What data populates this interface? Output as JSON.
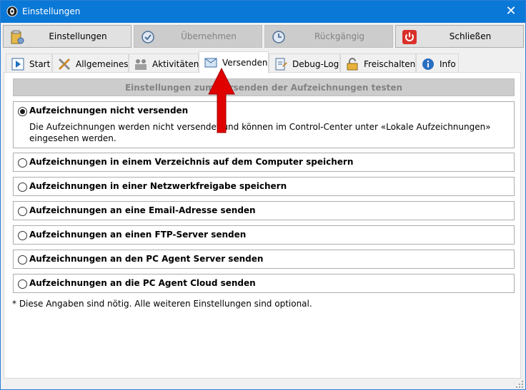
{
  "window": {
    "title": "Einstellungen",
    "close_glyph": "✕"
  },
  "toolbar": [
    {
      "label": "Einstellungen",
      "icon": "settings-folder-icon",
      "disabled": false
    },
    {
      "label": "Übernehmen",
      "icon": "apply-clock-icon",
      "disabled": true
    },
    {
      "label": "Rückgängig",
      "icon": "undo-clock-icon",
      "disabled": true
    },
    {
      "label": "Schließen",
      "icon": "power-icon",
      "disabled": false
    }
  ],
  "tabs": [
    {
      "label": "Start",
      "icon": "play-icon",
      "active": false
    },
    {
      "label": "Allgemeines",
      "icon": "tools-icon",
      "active": false
    },
    {
      "label": "Aktivitäten",
      "icon": "users-icon",
      "active": false
    },
    {
      "label": "Versenden",
      "icon": "envelope-icon",
      "active": true
    },
    {
      "label": "Debug-Log",
      "icon": "notepad-icon",
      "active": false
    },
    {
      "label": "Freischalten",
      "icon": "lock-icon",
      "active": false
    },
    {
      "label": "Info",
      "icon": "info-icon",
      "active": false
    }
  ],
  "panel": {
    "test_button": "Einstellungen zum Versenden der Aufzeichnungen testen",
    "options": [
      {
        "label": "Aufzeichnungen nicht versenden",
        "checked": true,
        "description": "Die Aufzeichnungen werden nicht versendet und können im Control-Center unter «Lokale Aufzeichnungen» eingesehen werden."
      },
      {
        "label": "Aufzeichnungen in einem Verzeichnis auf dem Computer speichern",
        "checked": false
      },
      {
        "label": "Aufzeichnungen in einer Netzwerkfreigabe speichern",
        "checked": false
      },
      {
        "label": "Aufzeichnungen an eine Email-Adresse senden",
        "checked": false
      },
      {
        "label": "Aufzeichnungen an einen FTP-Server senden",
        "checked": false
      },
      {
        "label": "Aufzeichnungen an den PC Agent Server senden",
        "checked": false
      },
      {
        "label": "Aufzeichnungen an die PC Agent Cloud senden",
        "checked": false
      }
    ],
    "footnote": "* Diese Angaben sind nötig. Alle weiteren Einstellungen sind optional."
  },
  "colors": {
    "titlebar": "#0a78d7",
    "arrow": "#e00000",
    "disabled_text": "#838383"
  }
}
